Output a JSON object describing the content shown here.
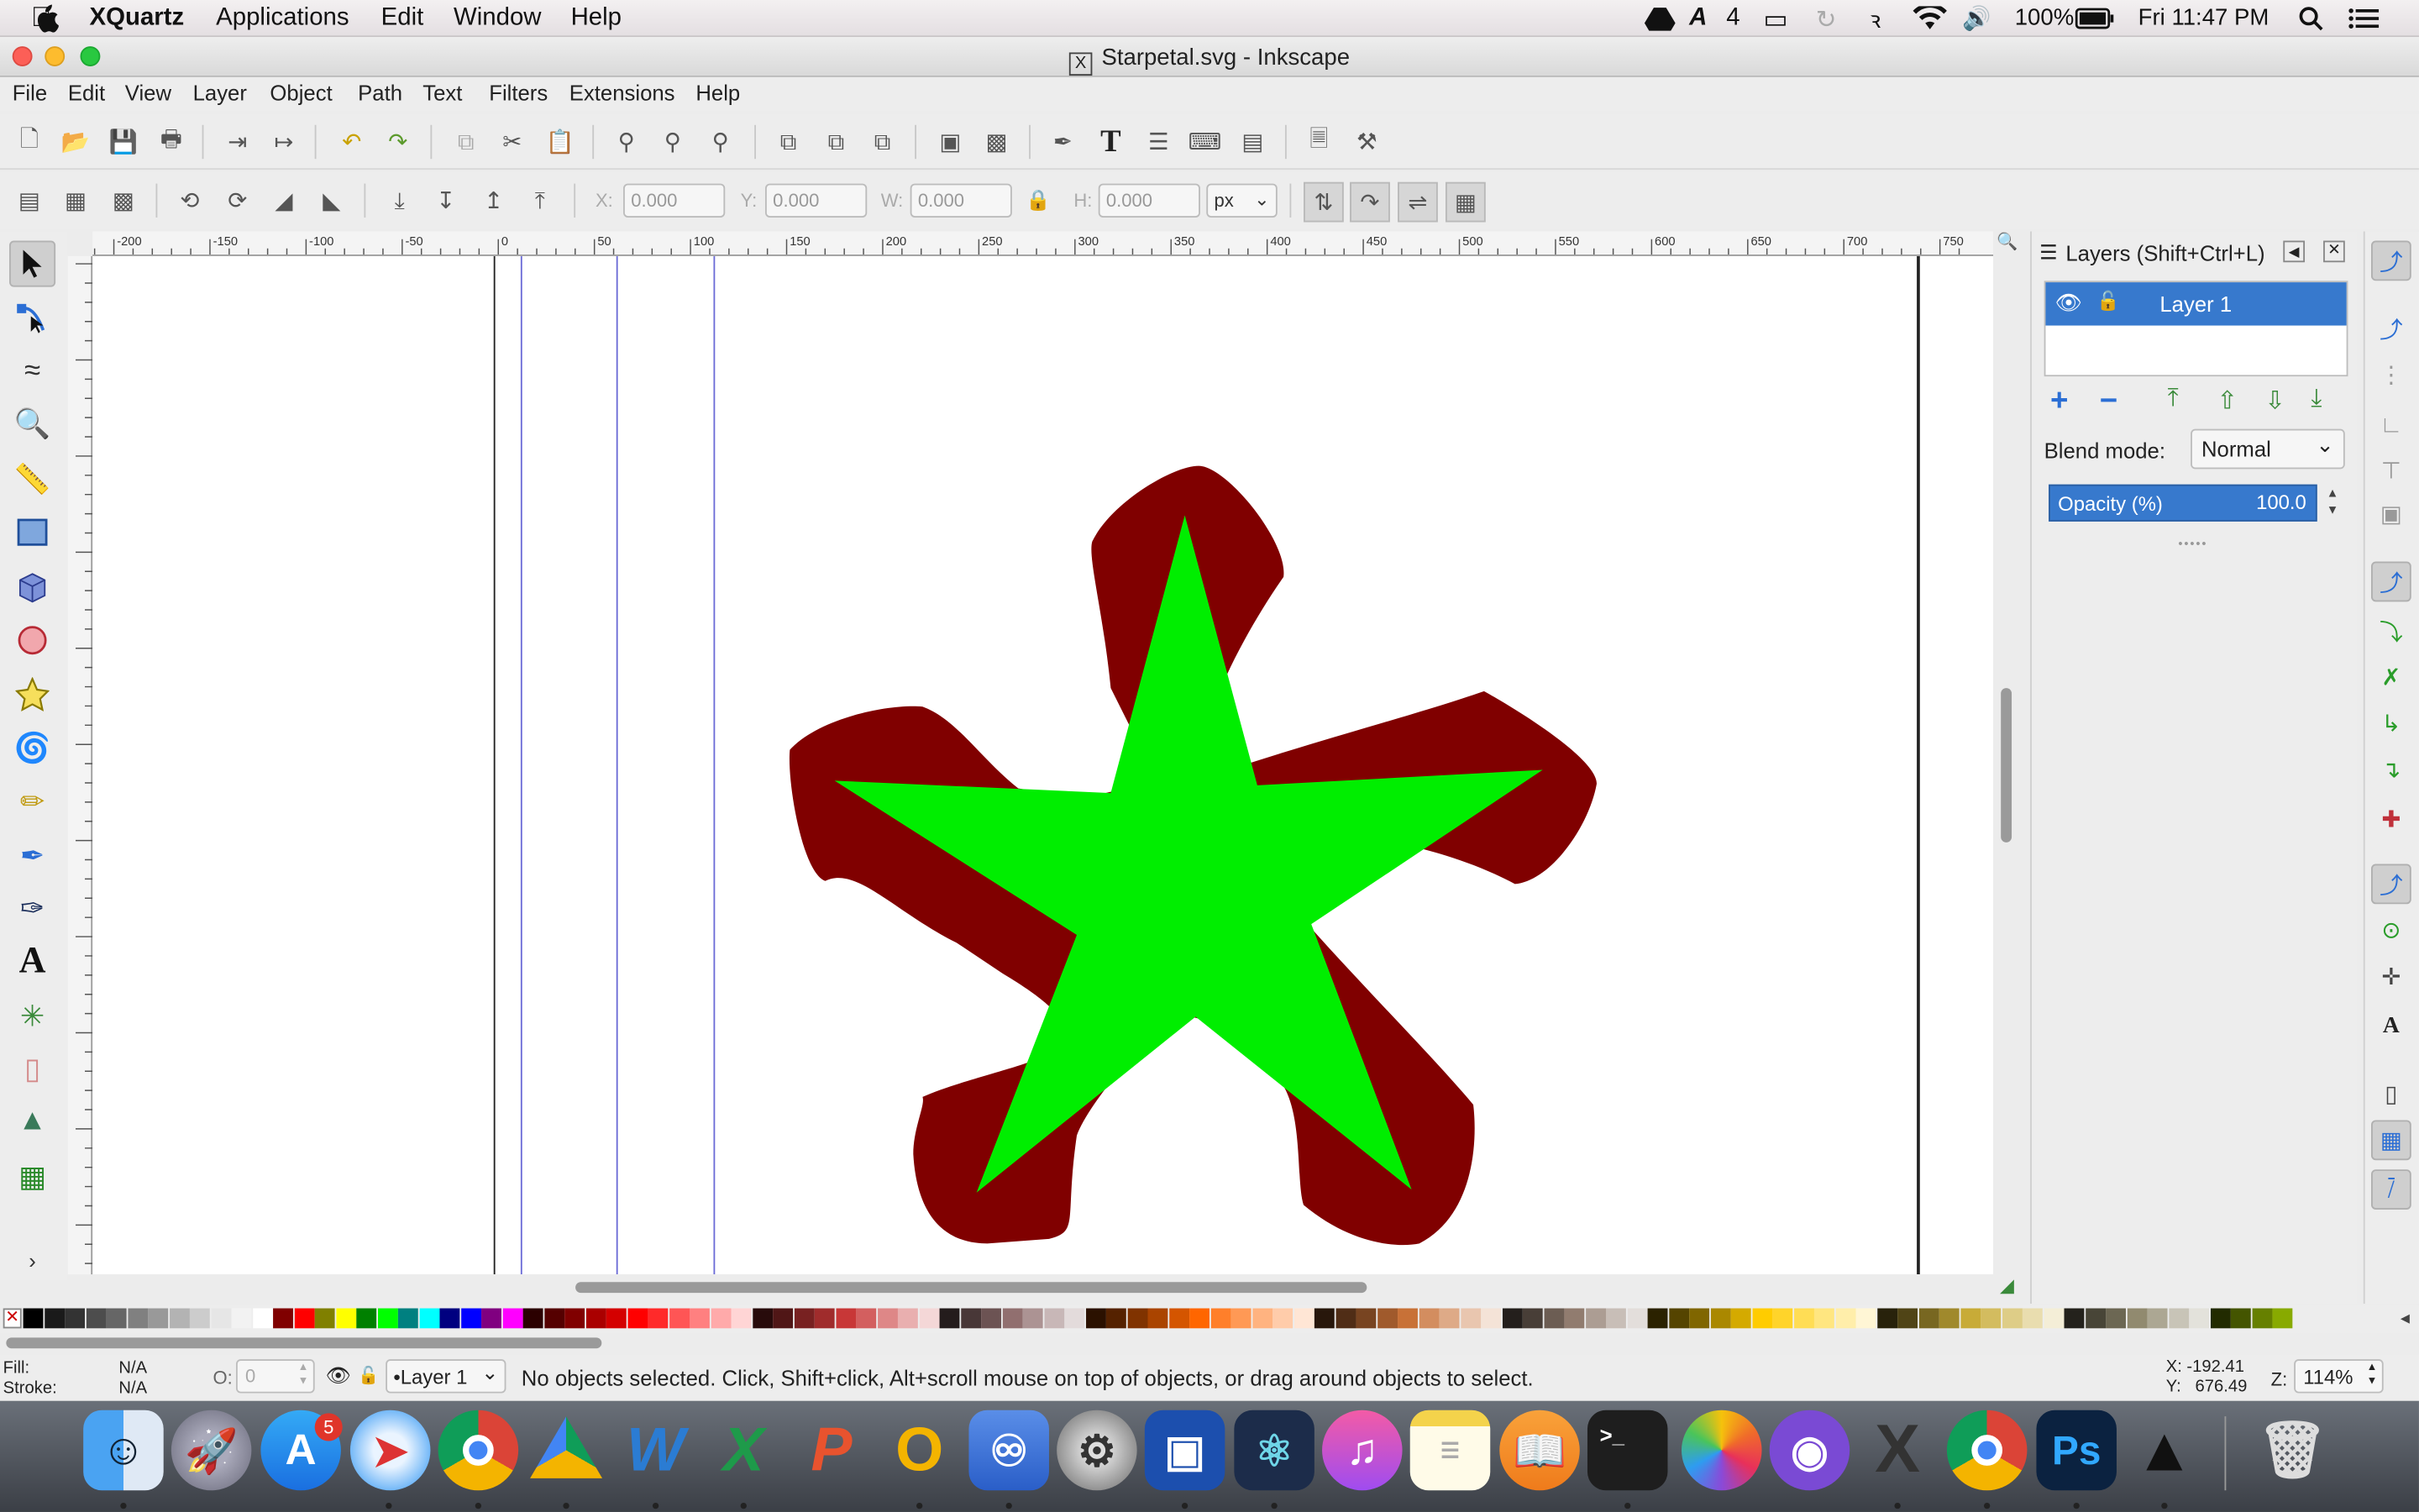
{
  "mac_menubar": {
    "app_name": "XQuartz",
    "menus": [
      "Applications",
      "Edit",
      "Window",
      "Help"
    ],
    "status": {
      "adobe_count": "4",
      "battery": "100%",
      "clock": "Fri 11:47 PM"
    }
  },
  "window": {
    "title": "Starpetal.svg - Inkscape"
  },
  "menubar": [
    "File",
    "Edit",
    "View",
    "Layer",
    "Object",
    "Path",
    "Text",
    "Filters",
    "Extensions",
    "Help"
  ],
  "tool_controls": {
    "x_label": "X:",
    "x_value": "0.000",
    "y_label": "Y:",
    "y_value": "0.000",
    "w_label": "W:",
    "w_value": "0.000",
    "h_label": "H:",
    "h_value": "0.000",
    "unit": "px"
  },
  "ruler": {
    "h_labels": [
      "-200",
      "-150",
      "-100",
      "-50",
      "0",
      "50",
      "100",
      "150",
      "200",
      "250",
      "300",
      "350",
      "400",
      "450",
      "500",
      "550",
      "600",
      "650",
      "700",
      "750"
    ]
  },
  "drawing": {
    "star_fill": "#00ee00",
    "petal_fill": "#800000"
  },
  "layers_panel": {
    "title": "Layers (Shift+Ctrl+L)",
    "layers": [
      {
        "name": "Layer 1",
        "selected": true
      }
    ],
    "blend_label": "Blend mode:",
    "blend_value": "Normal",
    "opacity_label": "Opacity (%)",
    "opacity_value": "100.0"
  },
  "palette": [
    "#000000",
    "#1a1a1a",
    "#333333",
    "#4d4d4d",
    "#666666",
    "#808080",
    "#999999",
    "#b3b3b3",
    "#cccccc",
    "#e6e6e6",
    "#f2f2f2",
    "#ffffff",
    "#800000",
    "#ff0000",
    "#808000",
    "#ffff00",
    "#008000",
    "#00ff00",
    "#008080",
    "#00ffff",
    "#000080",
    "#0000ff",
    "#800080",
    "#ff00ff",
    "#2b0000",
    "#550000",
    "#800000",
    "#aa0000",
    "#d40000",
    "#ff0000",
    "#ff2a2a",
    "#ff5555",
    "#ff8080",
    "#ffaaaa",
    "#ffd5d5",
    "#280b0b",
    "#501616",
    "#782121",
    "#a02c2c",
    "#c83737",
    "#d35f5f",
    "#de8787",
    "#e9afaf",
    "#f4d7d7",
    "#241c1c",
    "#483737",
    "#6c5353",
    "#916f6f",
    "#ac9393",
    "#c8b7b7",
    "#e3dbdb",
    "#2b1100",
    "#552200",
    "#803300",
    "#aa4400",
    "#d45500",
    "#ff6600",
    "#ff7f2a",
    "#ff9955",
    "#ffb380",
    "#ffccaa",
    "#ffe6d5",
    "#28170b",
    "#502d16",
    "#784421",
    "#a05a2c",
    "#c87137",
    "#d38d5f",
    "#deaa87",
    "#e9c6af",
    "#f4e3d7",
    "#241f1c",
    "#483e37",
    "#6c5d53",
    "#917c6f",
    "#ac9d93",
    "#c8beb7",
    "#e3dedb",
    "#2b2200",
    "#554400",
    "#806600",
    "#aa8800",
    "#d4aa00",
    "#ffcc00",
    "#ffd42a",
    "#ffdd55",
    "#ffe680",
    "#ffeeaa",
    "#fff6d5",
    "#28220b",
    "#504416",
    "#786721",
    "#a0892c",
    "#c8ab37",
    "#d3bc5f",
    "#decd87",
    "#e9ddaf",
    "#f4eed7",
    "#24221c",
    "#484537",
    "#6c6753",
    "#918a6f",
    "#aca793",
    "#c8c4b7",
    "#e3e2db",
    "#222b00",
    "#445500",
    "#668000",
    "#88aa00"
  ],
  "statusbar": {
    "fill_label": "Fill:",
    "fill_value": "N/A",
    "stroke_label": "Stroke:",
    "stroke_value": "N/A",
    "o_label": "O:",
    "o_value": "0",
    "layer_select": "•Layer 1",
    "message": "No objects selected. Click, Shift+click, Alt+scroll mouse on top of objects, or drag around objects to select.",
    "x_coord": "X: -192.41",
    "y_coord": "Y:   676.49",
    "zoom_label": "Z:",
    "zoom_value": "114%"
  },
  "dock": {
    "app_store_badge": "5"
  }
}
